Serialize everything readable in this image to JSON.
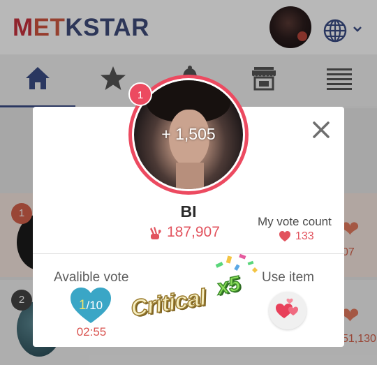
{
  "header": {
    "logo": {
      "m": "M",
      "e": "E",
      "t": "T",
      "rest": "KSTAR"
    }
  },
  "background_list": {
    "rows": [
      {
        "rank": "1",
        "count_fragment": "07"
      },
      {
        "rank": "2",
        "count_fragment": "51,130"
      }
    ]
  },
  "modal": {
    "rank_badge": "1",
    "vote_gain": "+ 1,505",
    "artist_name": "BI",
    "total_votes": "187,907",
    "my_vote_label": "My vote count",
    "my_vote_count": "133",
    "available_label": "Avalible vote",
    "available_current": "1",
    "available_max": "/10",
    "timer": "02:55",
    "use_item_label": "Use item",
    "critical_text": "Critical",
    "critical_multiplier": "x5"
  },
  "colors": {
    "accent_pink": "#ec4a60",
    "vote_red": "#e2535e",
    "nav_blue": "#3b4d86",
    "heart_teal": "#3aa6c6"
  },
  "icons": [
    "home-icon",
    "star-icon",
    "bell-icon",
    "store-icon",
    "list-icon",
    "globe-icon",
    "chevron-down-icon",
    "close-icon",
    "vote-hand-icon",
    "heart-icon",
    "hearts-item-icon"
  ]
}
